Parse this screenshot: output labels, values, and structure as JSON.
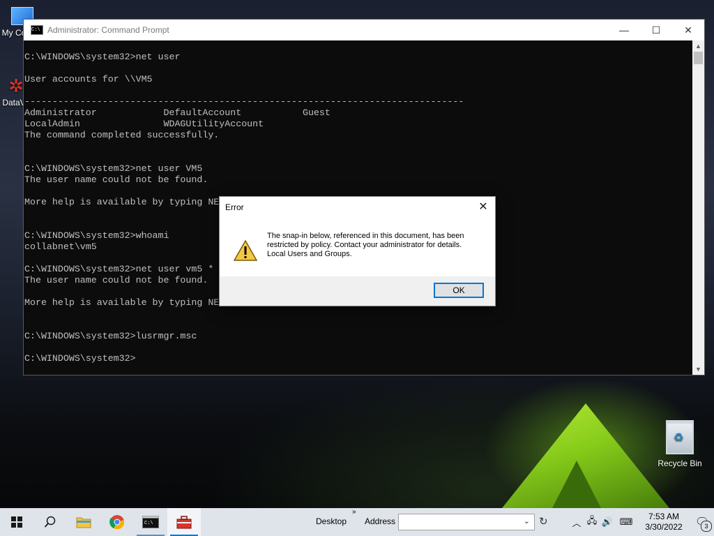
{
  "desktop": {
    "icons": [
      {
        "label": "My Co"
      },
      {
        "label": "DataV"
      },
      {
        "label": "Recycle Bin"
      }
    ]
  },
  "cmd_window": {
    "title": "Administrator: Command Prompt",
    "controls": {
      "minimize": "—",
      "maximize": "☐",
      "close": "✕"
    },
    "lines": [
      "",
      "C:\\WINDOWS\\system32>net user",
      "",
      "User accounts for \\\\VM5",
      "",
      "-------------------------------------------------------------------------------",
      "Administrator            DefaultAccount           Guest",
      "LocalAdmin               WDAGUtilityAccount",
      "The command completed successfully.",
      "",
      "",
      "C:\\WINDOWS\\system32>net user VM5",
      "The user name could not be found.",
      "",
      "More help is available by typing NE",
      "",
      "",
      "C:\\WINDOWS\\system32>whoami",
      "collabnet\\vm5",
      "",
      "C:\\WINDOWS\\system32>net user vm5 *",
      "The user name could not be found.",
      "",
      "More help is available by typing NET HELPMSG 2221.",
      "",
      "",
      "C:\\WINDOWS\\system32>lusrmgr.msc",
      "",
      "C:\\WINDOWS\\system32>"
    ]
  },
  "dialog": {
    "title": "Error",
    "message": "The snap-in below, referenced in this document, has been restricted by policy. Contact your administrator for details.",
    "detail": "Local Users and Groups.",
    "ok_label": "OK",
    "icon": "warning-icon"
  },
  "taskbar": {
    "desktop_label": "Desktop",
    "toolbar_chevron": "»",
    "address_label": "Address",
    "address_value": "",
    "time": "7:53 AM",
    "date": "3/30/2022",
    "notification_count": "3"
  },
  "colors": {
    "cmd_bg": "#0c0c0c",
    "cmd_text": "#c0c0c0",
    "accent": "#0078d7",
    "taskbar_bg": "#dfe4ea"
  }
}
